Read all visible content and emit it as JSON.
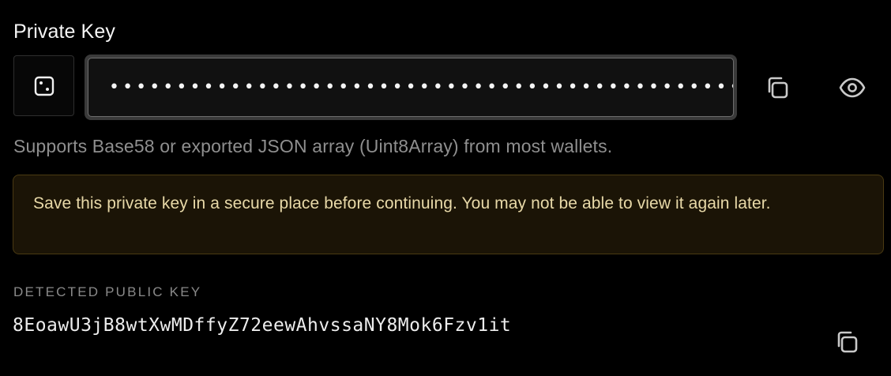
{
  "field": {
    "label": "Private Key",
    "value": "••••••••••••••••••••••••••••••••••••••••••••••••••••••••••••••••••••••••••••••••••••••••",
    "helper": "Supports Base58 or exported JSON array (Uint8Array) from most wallets."
  },
  "warning": {
    "text": "Save this private key in a secure place before continuing. You may not be able to view it again later."
  },
  "public_key": {
    "label": "DETECTED PUBLIC KEY",
    "value": "8EoawU3jB8wtXwMDffyZ72eewAhvssaNY8Mok6Fzv1it"
  },
  "icons": {
    "generate": "dice-icon",
    "copy": "copy-icon",
    "reveal": "eye-icon"
  },
  "colors": {
    "background": "#000000",
    "warning_bg": "#1b1406",
    "warning_border": "#4a3a12",
    "warning_text": "#e8d9a8",
    "muted_text": "#8f8f8f"
  }
}
